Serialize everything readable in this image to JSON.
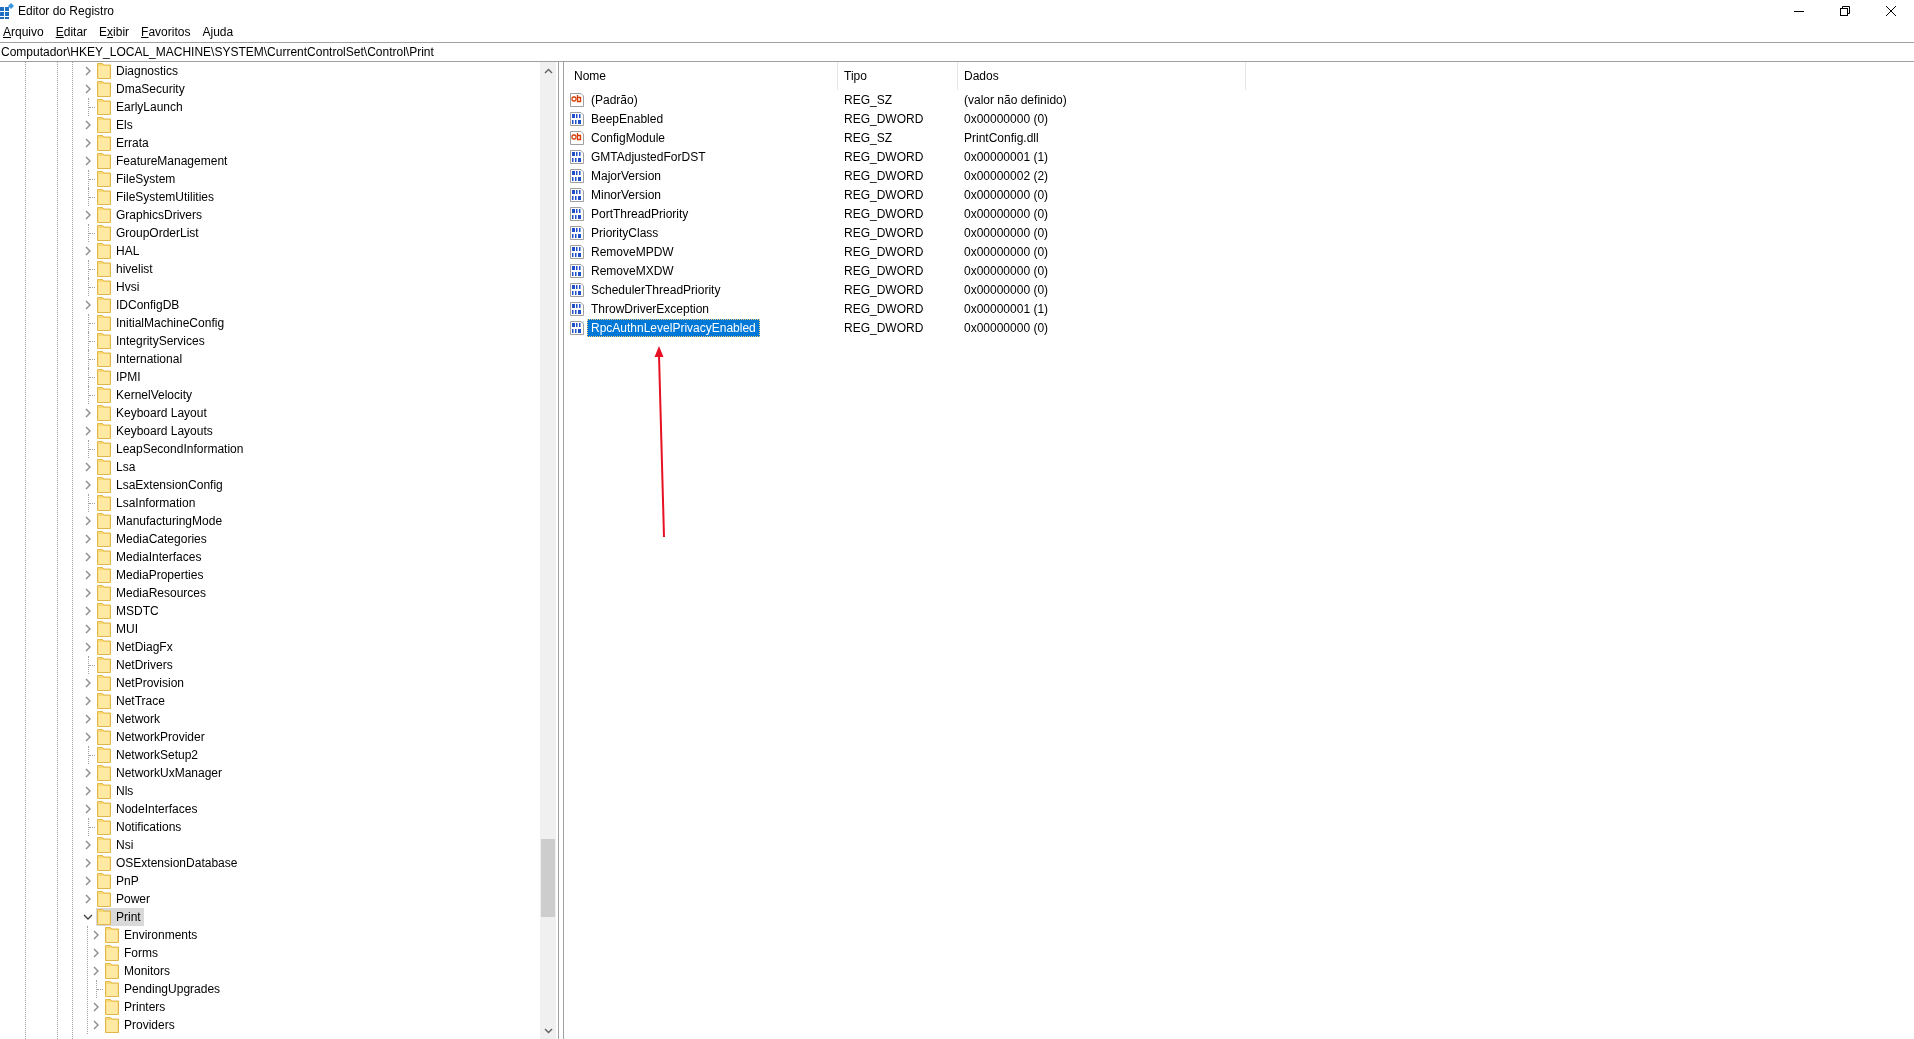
{
  "window": {
    "title": "Editor do Registro"
  },
  "menu": [
    {
      "key": "A",
      "after": "rquivo"
    },
    {
      "key": "E",
      "after": "ditar"
    },
    {
      "before": "E",
      "key": "x",
      "after": "ibir"
    },
    {
      "key": "F",
      "after": "avoritos"
    },
    {
      "before": "A",
      "key": "j",
      "after": "uda"
    }
  ],
  "address": "Computador\\HKEY_LOCAL_MACHINE\\SYSTEM\\CurrentControlSet\\Control\\Print",
  "tree": [
    {
      "name": "Diagnostics",
      "expandable": true,
      "selected": false
    },
    {
      "name": "DmaSecurity",
      "expandable": true,
      "selected": false
    },
    {
      "name": "EarlyLaunch",
      "expandable": false,
      "selected": false
    },
    {
      "name": "Els",
      "expandable": true,
      "selected": false
    },
    {
      "name": "Errata",
      "expandable": true,
      "selected": false
    },
    {
      "name": "FeatureManagement",
      "expandable": true,
      "selected": false
    },
    {
      "name": "FileSystem",
      "expandable": false,
      "selected": false
    },
    {
      "name": "FileSystemUtilities",
      "expandable": false,
      "selected": false
    },
    {
      "name": "GraphicsDrivers",
      "expandable": true,
      "selected": false
    },
    {
      "name": "GroupOrderList",
      "expandable": false,
      "selected": false
    },
    {
      "name": "HAL",
      "expandable": true,
      "selected": false
    },
    {
      "name": "hivelist",
      "expandable": false,
      "selected": false
    },
    {
      "name": "Hvsi",
      "expandable": false,
      "selected": false
    },
    {
      "name": "IDConfigDB",
      "expandable": true,
      "selected": false
    },
    {
      "name": "InitialMachineConfig",
      "expandable": false,
      "selected": false
    },
    {
      "name": "IntegrityServices",
      "expandable": false,
      "selected": false
    },
    {
      "name": "International",
      "expandable": false,
      "selected": false
    },
    {
      "name": "IPMI",
      "expandable": false,
      "selected": false
    },
    {
      "name": "KernelVelocity",
      "expandable": false,
      "selected": false
    },
    {
      "name": "Keyboard Layout",
      "expandable": true,
      "selected": false
    },
    {
      "name": "Keyboard Layouts",
      "expandable": true,
      "selected": false
    },
    {
      "name": "LeapSecondInformation",
      "expandable": false,
      "selected": false
    },
    {
      "name": "Lsa",
      "expandable": true,
      "selected": false
    },
    {
      "name": "LsaExtensionConfig",
      "expandable": true,
      "selected": false
    },
    {
      "name": "LsaInformation",
      "expandable": false,
      "selected": false
    },
    {
      "name": "ManufacturingMode",
      "expandable": true,
      "selected": false
    },
    {
      "name": "MediaCategories",
      "expandable": true,
      "selected": false
    },
    {
      "name": "MediaInterfaces",
      "expandable": true,
      "selected": false
    },
    {
      "name": "MediaProperties",
      "expandable": true,
      "selected": false
    },
    {
      "name": "MediaResources",
      "expandable": true,
      "selected": false
    },
    {
      "name": "MSDTC",
      "expandable": true,
      "selected": false
    },
    {
      "name": "MUI",
      "expandable": true,
      "selected": false
    },
    {
      "name": "NetDiagFx",
      "expandable": true,
      "selected": false
    },
    {
      "name": "NetDrivers",
      "expandable": false,
      "selected": false
    },
    {
      "name": "NetProvision",
      "expandable": true,
      "selected": false
    },
    {
      "name": "NetTrace",
      "expandable": true,
      "selected": false
    },
    {
      "name": "Network",
      "expandable": true,
      "selected": false
    },
    {
      "name": "NetworkProvider",
      "expandable": true,
      "selected": false
    },
    {
      "name": "NetworkSetup2",
      "expandable": false,
      "selected": false
    },
    {
      "name": "NetworkUxManager",
      "expandable": true,
      "selected": false
    },
    {
      "name": "Nls",
      "expandable": true,
      "selected": false
    },
    {
      "name": "NodeInterfaces",
      "expandable": true,
      "selected": false
    },
    {
      "name": "Notifications",
      "expandable": false,
      "selected": false
    },
    {
      "name": "Nsi",
      "expandable": true,
      "selected": false
    },
    {
      "name": "OSExtensionDatabase",
      "expandable": true,
      "selected": false
    },
    {
      "name": "PnP",
      "expandable": true,
      "selected": false
    },
    {
      "name": "Power",
      "expandable": true,
      "selected": false
    },
    {
      "name": "Print",
      "expandable": true,
      "selected": true,
      "children": [
        {
          "name": "Environments",
          "expandable": true,
          "selected": false
        },
        {
          "name": "Forms",
          "expandable": true,
          "selected": false
        },
        {
          "name": "Monitors",
          "expandable": true,
          "selected": false
        },
        {
          "name": "PendingUpgrades",
          "expandable": false,
          "selected": false
        },
        {
          "name": "Printers",
          "expandable": true,
          "selected": false
        },
        {
          "name": "Providers",
          "expandable": true,
          "selected": false
        }
      ]
    }
  ],
  "values": {
    "columns": [
      "Nome",
      "Tipo",
      "Dados"
    ],
    "rows": [
      {
        "kind": "sz",
        "name": "(Padrão)",
        "type": "REG_SZ",
        "data": "(valor não definido)",
        "selected": false
      },
      {
        "kind": "dword",
        "name": "BeepEnabled",
        "type": "REG_DWORD",
        "data": "0x00000000 (0)",
        "selected": false
      },
      {
        "kind": "sz",
        "name": "ConfigModule",
        "type": "REG_SZ",
        "data": "PrintConfig.dll",
        "selected": false
      },
      {
        "kind": "dword",
        "name": "GMTAdjustedForDST",
        "type": "REG_DWORD",
        "data": "0x00000001 (1)",
        "selected": false
      },
      {
        "kind": "dword",
        "name": "MajorVersion",
        "type": "REG_DWORD",
        "data": "0x00000002 (2)",
        "selected": false
      },
      {
        "kind": "dword",
        "name": "MinorVersion",
        "type": "REG_DWORD",
        "data": "0x00000000 (0)",
        "selected": false
      },
      {
        "kind": "dword",
        "name": "PortThreadPriority",
        "type": "REG_DWORD",
        "data": "0x00000000 (0)",
        "selected": false
      },
      {
        "kind": "dword",
        "name": "PriorityClass",
        "type": "REG_DWORD",
        "data": "0x00000000 (0)",
        "selected": false
      },
      {
        "kind": "dword",
        "name": "RemoveMPDW",
        "type": "REG_DWORD",
        "data": "0x00000000 (0)",
        "selected": false
      },
      {
        "kind": "dword",
        "name": "RemoveMXDW",
        "type": "REG_DWORD",
        "data": "0x00000000 (0)",
        "selected": false
      },
      {
        "kind": "dword",
        "name": "SchedulerThreadPriority",
        "type": "REG_DWORD",
        "data": "0x00000000 (0)",
        "selected": false
      },
      {
        "kind": "dword",
        "name": "ThrowDriverException",
        "type": "REG_DWORD",
        "data": "0x00000001 (1)",
        "selected": false
      },
      {
        "kind": "dword",
        "name": "RpcAuthnLevelPrivacyEnabled",
        "type": "REG_DWORD",
        "data": "0x00000000 (0)",
        "selected": true
      }
    ]
  }
}
